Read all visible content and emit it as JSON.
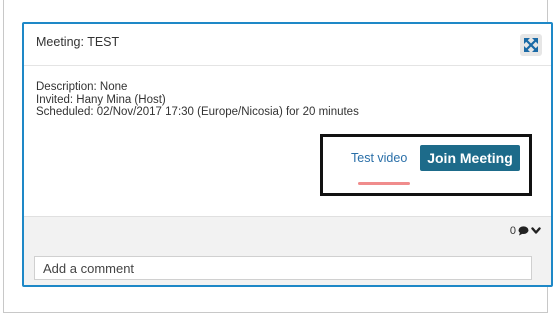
{
  "meeting": {
    "title": "Meeting: TEST",
    "description": "Description: None",
    "invited": "Invited: Hany Mina (Host)",
    "scheduled": "Scheduled: 02/Nov/2017 17:30 (Europe/Nicosia) for 20 minutes"
  },
  "actions": {
    "test_video_label": "Test video",
    "join_label": "Join Meeting"
  },
  "comments": {
    "count": "0",
    "placeholder": "Add a comment"
  },
  "icons": {
    "expand": "expand-arrows-icon",
    "comment": "speech-bubble-icon",
    "toggle": "chevron-down-icon"
  },
  "colors": {
    "card_border": "#1e88c7",
    "join_button": "#1d6b8a",
    "expand_icon": "#1a6aa6",
    "highlight_underline": "#f08c8c"
  }
}
